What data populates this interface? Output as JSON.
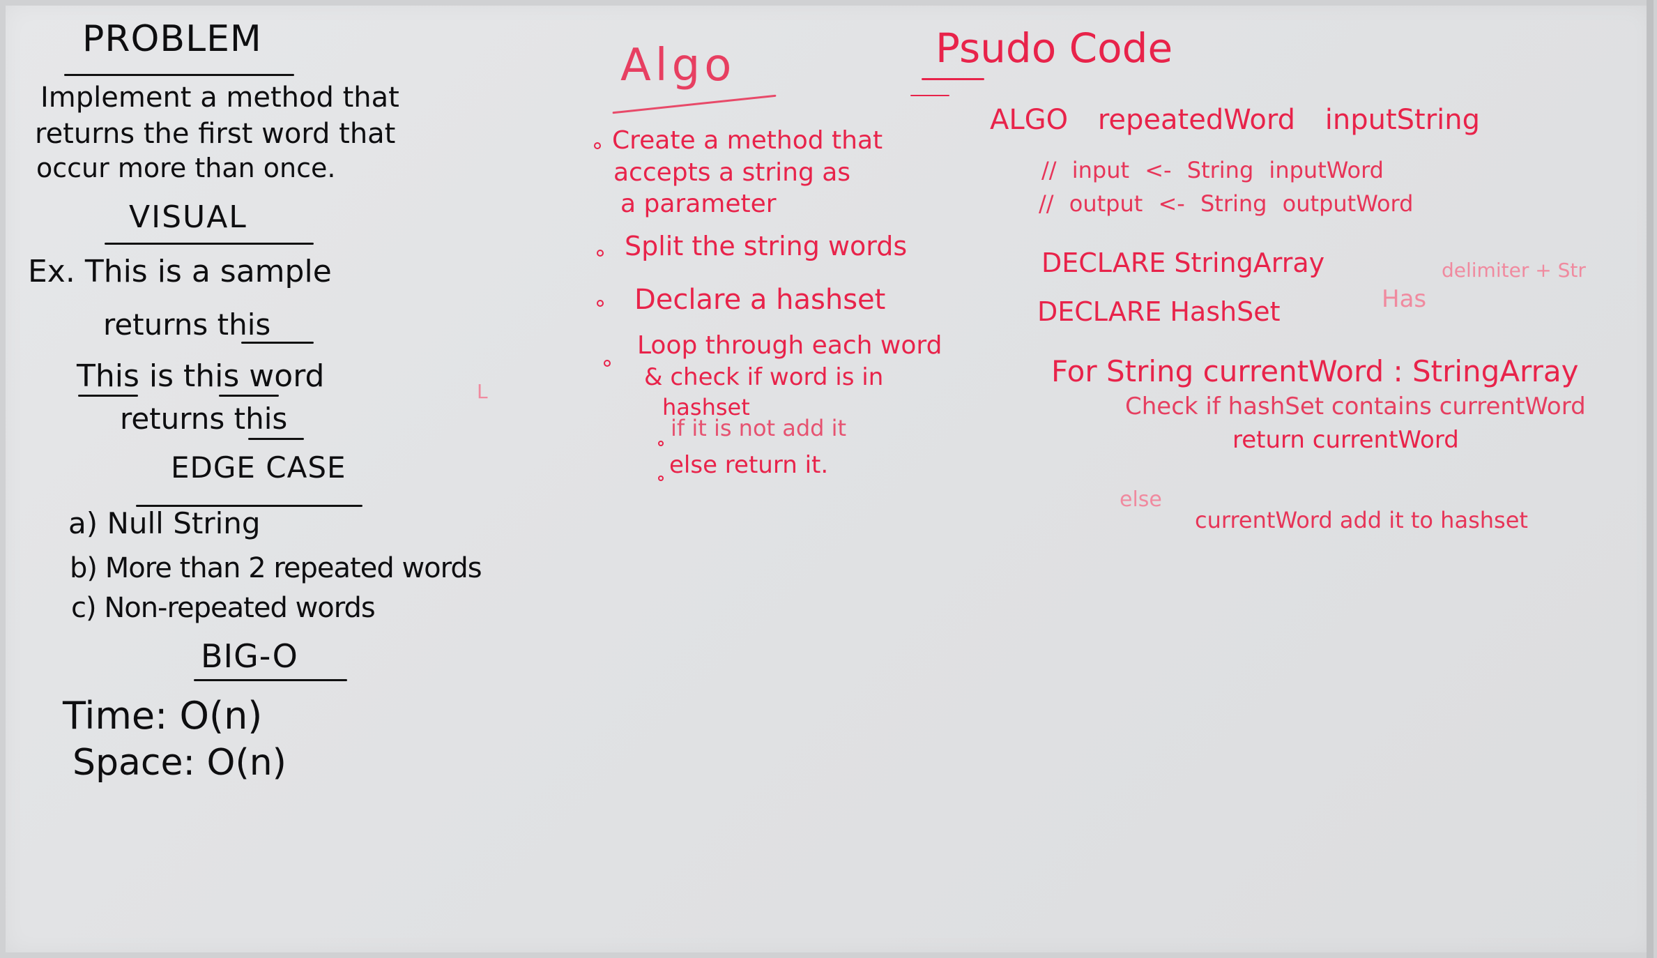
{
  "left": {
    "problem_heading": "PROBLEM",
    "problem_lines": [
      "Implement a method that",
      "returns the first word that",
      "occur more than once."
    ],
    "visual_heading": "VISUAL",
    "example_1": "Ex. This is a sample",
    "example_1_result": "returns this",
    "example_2": "This is this word",
    "example_2_result": "returns this",
    "edge_heading": "EDGE CASE",
    "edge_cases": [
      "a) Null String",
      "b) More than 2 repeated words",
      "c) Non-repeated words"
    ],
    "bigo_heading": "BIG-O",
    "time": "Time: O(n)",
    "space": "Space: O(n)"
  },
  "middle": {
    "algo_heading": "Algo",
    "steps": [
      "Create a method that",
      "accepts a string as",
      "a parameter",
      "Split the string words",
      "Declare a hashset",
      "Loop through each word",
      "& check if word is in",
      "hashset",
      "if it is not add it",
      "else return it."
    ]
  },
  "right": {
    "pseudo_heading": "Psudo Code",
    "lines": [
      "ALGO repeatedWord inputString",
      "// input <- String inputWord",
      "// output <- String outputWord",
      "DECLARE StringArray",
      "delimiter + Str",
      "DECLARE HashSet",
      "Has",
      "For String currentWord : StringArray",
      "Check if hashSet contains currentWord",
      "return currentWord",
      "else",
      "currentWord add it to hashset"
    ]
  },
  "colors": {
    "black_ink": "#0e0e10",
    "red_ink": "#e8234a",
    "board": "#e3e4e6"
  }
}
